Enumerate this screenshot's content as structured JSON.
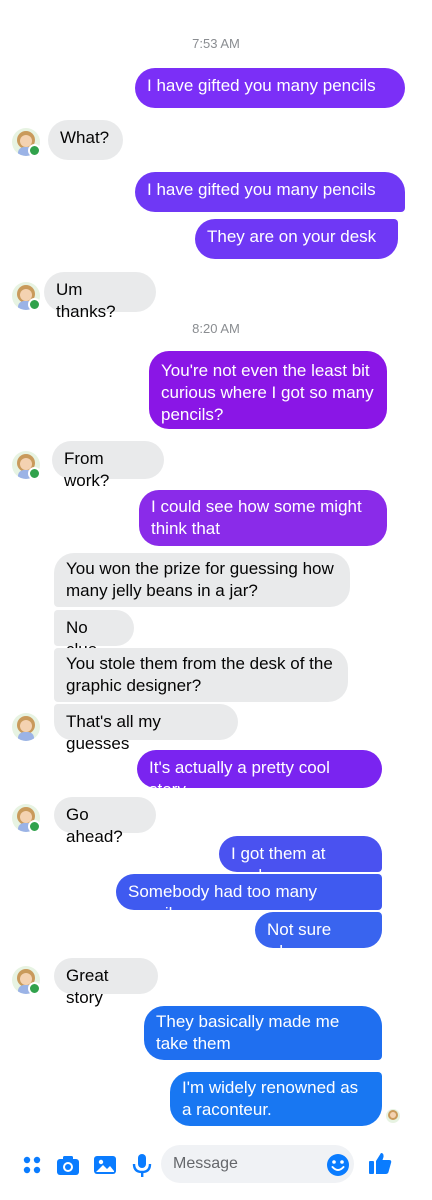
{
  "conversation": {
    "timestamps": [
      "7:53 AM",
      "8:20 AM"
    ],
    "messages": [
      {
        "text": "I have gifted you many pencils"
      },
      {
        "text": "What?"
      },
      {
        "text": "I have gifted you many pencils"
      },
      {
        "text": "They are on your desk"
      },
      {
        "text": "Um thanks?"
      },
      {
        "text": "You're not even the least bit curious where I got so many pencils?"
      },
      {
        "text": "From work?"
      },
      {
        "text": "I could see how some might think that"
      },
      {
        "text": "You won the prize for guessing how many jelly beans in a jar?"
      },
      {
        "text": "No clue"
      },
      {
        "text": "You stole them from the desk of the graphic designer?"
      },
      {
        "text": "That's all my guesses"
      },
      {
        "text": "It's actually a pretty cool story"
      },
      {
        "text": "Go ahead?"
      },
      {
        "text": "I got them at work."
      },
      {
        "text": "Somebody had too many pencils"
      },
      {
        "text": "Not sure who."
      },
      {
        "text": "Great story"
      },
      {
        "text": "They basically made me take them"
      },
      {
        "text": "I'm widely renowned as a raconteur."
      }
    ]
  },
  "composer": {
    "placeholder": "Message",
    "icons": [
      "apps-icon",
      "camera-icon",
      "gallery-icon",
      "microphone-icon",
      "emoji-icon",
      "like-icon"
    ]
  },
  "colors": {
    "incoming": "#e9eaeb",
    "out_purple": "#8a16e6",
    "out_violet": "#7b2ff7",
    "out_indigo": "#5b45f0",
    "out_blue": "#3b5bef",
    "out_azure": "#1877f2",
    "accent": "#0a7cff"
  }
}
